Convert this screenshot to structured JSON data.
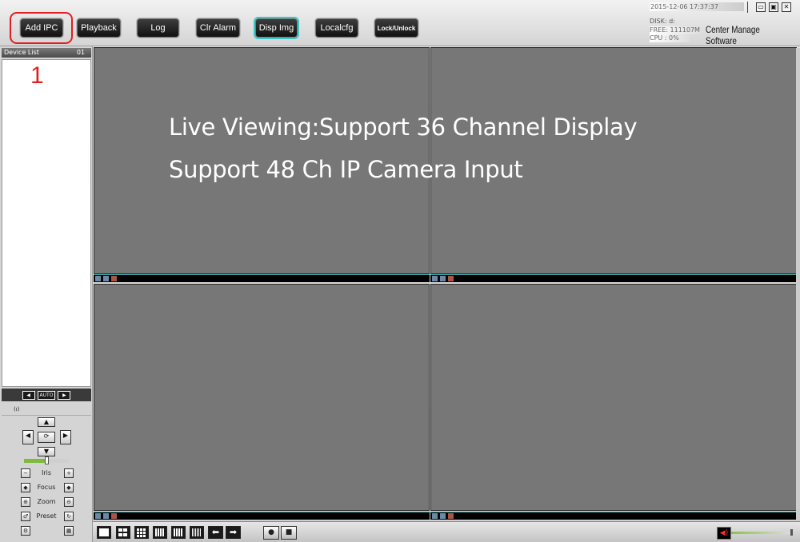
{
  "toolbar": {
    "buttons": [
      {
        "label": "Add IPC"
      },
      {
        "label": "Playback"
      },
      {
        "label": "Log"
      },
      {
        "label": "Clr Alarm"
      },
      {
        "label": "Disp Img"
      },
      {
        "label": "Localcfg"
      },
      {
        "label": "Lock/Unlock"
      }
    ],
    "active_button": "Disp Img",
    "highlight_color": "#e02020",
    "active_color": "#3cc8c8"
  },
  "annotation": {
    "step_number": "1"
  },
  "status": {
    "datetime": "2015-12-06 17:37:37",
    "disk": "DISK: d:",
    "free": "FREE: 111107M",
    "cpu": "CPU : 0%"
  },
  "app_title": "Center Manage Software",
  "window_controls": [
    "minimize-icon",
    "maximize-icon",
    "close-icon"
  ],
  "device_list": {
    "header": "Device List",
    "count": "01",
    "pager": {
      "prev": "◀",
      "auto": "AUTO",
      "next": "▶"
    }
  },
  "ptz": {
    "header": "(ı)",
    "labels": {
      "iris": "Iris",
      "focus": "Focus",
      "zoom": "Zoom",
      "preset": "Preset"
    },
    "speed_level": 0.48
  },
  "overlay": {
    "line1": "Live Viewing:Support 36 Channel Display",
    "line2": "Support 48 Ch IP Camera Input"
  },
  "video": {
    "background": "#777777",
    "cells": 4
  },
  "bottom": {
    "layouts": [
      "1-view",
      "4-view",
      "9-view",
      "16-view",
      "25-view",
      "36-view"
    ],
    "nav": {
      "prev": "⬅",
      "next": "➡"
    },
    "record_icons": [
      "record-start-icon",
      "record-stop-icon"
    ],
    "volume_level": 0.9
  }
}
